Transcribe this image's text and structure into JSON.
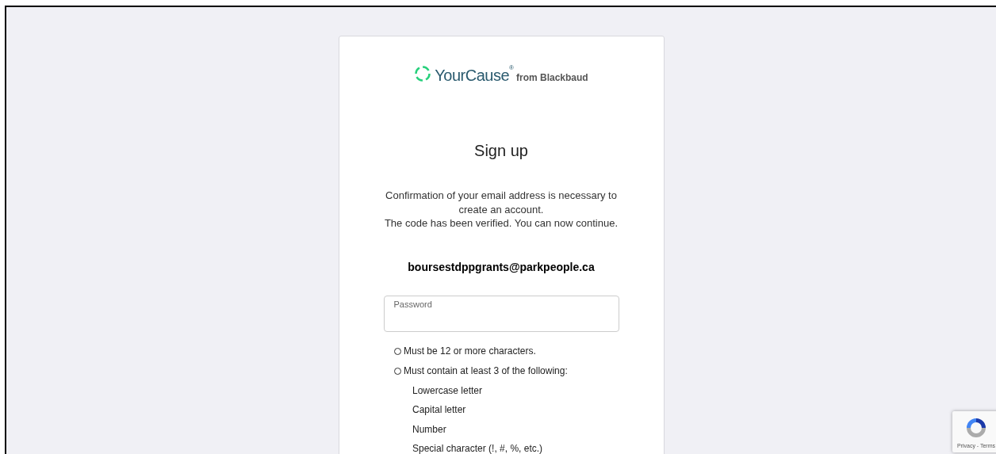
{
  "logo": {
    "brand": "YourCause",
    "registered": "®",
    "suffix": "from Blackbaud"
  },
  "title": "Sign up",
  "message": [
    "Confirmation of your email address is necessary to create an account.",
    "The code has been verified. You can now continue."
  ],
  "email": "boursestdppgrants@parkpeople.ca",
  "password_field": {
    "placeholder": "Password"
  },
  "requirements": [
    {
      "text": "Must be 12 or more characters.",
      "met": false
    },
    {
      "text": "Must contain at least 3 of the following:",
      "met": false,
      "children": [
        "Lowercase letter",
        "Capital letter",
        "Number",
        "Special character (!, #, %, etc.)"
      ]
    }
  ],
  "recaptcha": {
    "links": "Privacy - Terms"
  }
}
